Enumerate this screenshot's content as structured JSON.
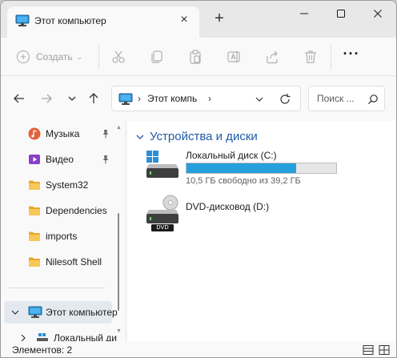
{
  "tab": {
    "title": "Этот компьютер",
    "close_glyph": "×",
    "new_tab_glyph": "+"
  },
  "toolbar": {
    "create_label": "Создать",
    "create_chevron": "⌄",
    "more_glyph": "···"
  },
  "address": {
    "separator": "›",
    "location": "Этот компь",
    "search_placeholder": "Поиск ..."
  },
  "sidebar": {
    "items": [
      {
        "label": "Музыка",
        "icon": "music-icon",
        "pinned": true
      },
      {
        "label": "Видео",
        "icon": "video-icon",
        "pinned": true
      },
      {
        "label": "System32",
        "icon": "folder-icon",
        "pinned": false
      },
      {
        "label": "Dependencies",
        "icon": "folder-icon",
        "pinned": false
      },
      {
        "label": "imports",
        "icon": "folder-icon",
        "pinned": false
      },
      {
        "label": "Nilesoft Shell",
        "icon": "folder-icon",
        "pinned": false
      }
    ],
    "tree": [
      {
        "label": "Этот компьютер",
        "icon": "pc-icon",
        "selected": true
      },
      {
        "label": "Локальный ди",
        "icon": "drive-icon",
        "selected": false
      }
    ]
  },
  "content": {
    "group_title": "Устройства и диски",
    "drives": [
      {
        "name": "Локальный диск (C:)",
        "free": "10,5 ГБ свободно из 39,2 ГБ",
        "used_fraction": 0.732,
        "icon": "windows-drive-icon"
      },
      {
        "name": "DVD-дисковод (D:)",
        "badge": "DVD",
        "icon": "dvd-drive-icon"
      }
    ]
  },
  "status": {
    "items": "Элементов: 2"
  },
  "colors": {
    "accent": "#26a0da",
    "group_title": "#1e5aa8",
    "folder": "#f4c14a"
  }
}
